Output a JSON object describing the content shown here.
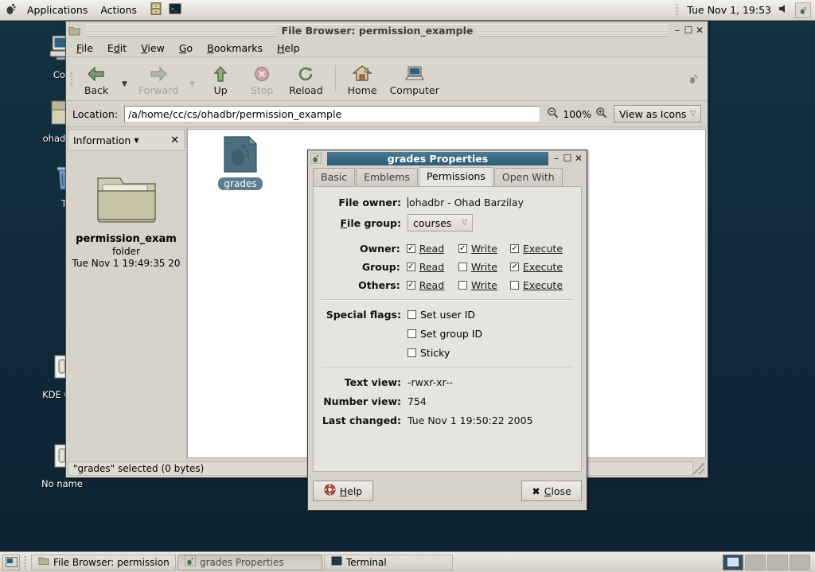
{
  "panel": {
    "menus": [
      "Applications",
      "Actions"
    ],
    "launchers": [
      "file-cabinet-icon",
      "terminal-icon"
    ],
    "clock": "Tue Nov  1, 19:53",
    "tray": [
      "volume-icon",
      "gnome-foot-icon"
    ]
  },
  "desktop": {
    "icons": [
      {
        "name": "Computer",
        "label": "Con",
        "icon": "computer-icon"
      },
      {
        "name": "ohadbr",
        "label": "ohadbr",
        "icon": "home-folder-icon"
      },
      {
        "name": "Trash",
        "label": "Tr",
        "icon": "trash-icon"
      },
      {
        "name": "KDE Connect",
        "label": "KDE Con",
        "icon": "drive-icon"
      },
      {
        "name": "No name",
        "label": "No name",
        "icon": "drive-icon"
      }
    ]
  },
  "file_browser": {
    "title": "File Browser: permission_example",
    "window_buttons": [
      "minimize",
      "maximize",
      "close"
    ],
    "menu": [
      "File",
      "Edit",
      "View",
      "Go",
      "Bookmarks",
      "Help"
    ],
    "toolbar": [
      {
        "label": "Back",
        "icon": "back-arrow-icon",
        "disabled": false,
        "has_menu": true
      },
      {
        "label": "Forward",
        "icon": "forward-arrow-icon",
        "disabled": true,
        "has_menu": true
      },
      {
        "label": "Up",
        "icon": "up-arrow-icon",
        "disabled": false,
        "has_menu": false
      },
      {
        "label": "Stop",
        "icon": "stop-icon",
        "disabled": true,
        "has_menu": false
      },
      {
        "label": "Reload",
        "icon": "reload-icon",
        "disabled": false,
        "has_menu": false
      },
      {
        "label": "Home",
        "icon": "home-icon",
        "disabled": false,
        "has_menu": false
      },
      {
        "label": "Computer",
        "icon": "computer-icon",
        "disabled": false,
        "has_menu": false
      }
    ],
    "location": {
      "label": "Location:",
      "value": "/a/home/cc/cs/ohadbr/permission_example",
      "placeholder": "Location"
    },
    "zoom": {
      "value": "100%",
      "out_icon": "zoom-out-icon",
      "in_icon": "zoom-in-icon"
    },
    "view_selector": "View as Icons",
    "sidepane": {
      "header": "Information",
      "close": "✕",
      "item_name": "permission_exam",
      "item_type": "folder",
      "item_date": "Tue Nov  1 19:49:35 20"
    },
    "files": [
      {
        "name": "grades",
        "icon": "gnome-document-icon",
        "selected": true
      }
    ],
    "status": "\"grades\" selected (0 bytes)"
  },
  "properties_dialog": {
    "title": "grades Properties",
    "tabs": [
      {
        "label": "Basic",
        "active": false
      },
      {
        "label": "Emblems",
        "active": false
      },
      {
        "label": "Permissions",
        "active": true
      },
      {
        "label": "Open With",
        "active": false
      }
    ],
    "file_owner": {
      "label": "File owner:",
      "value": "ohadbr - Ohad Barzilay"
    },
    "file_group": {
      "label": "File group:",
      "value": "courses"
    },
    "permissions": [
      {
        "label": "Owner:",
        "read": true,
        "write": true,
        "execute": true
      },
      {
        "label": "Group:",
        "read": true,
        "write": false,
        "execute": true
      },
      {
        "label": "Others:",
        "read": true,
        "write": false,
        "execute": false
      }
    ],
    "permission_columns": [
      "Read",
      "Write",
      "Execute"
    ],
    "special_flags": {
      "label": "Special flags:",
      "items": [
        {
          "label": "Set user ID",
          "checked": false
        },
        {
          "label": "Set group ID",
          "checked": false
        },
        {
          "label": "Sticky",
          "checked": false
        }
      ]
    },
    "summary": [
      {
        "label": "Text view:",
        "value": "-rwxr-xr--"
      },
      {
        "label": "Number view:",
        "value": "754"
      },
      {
        "label": "Last changed:",
        "value": "Tue Nov  1 19:50:22 2005"
      }
    ],
    "buttons": [
      {
        "label": "Help",
        "icon": "help-icon"
      },
      {
        "label": "Close",
        "icon": "close-x-icon"
      }
    ]
  },
  "taskbar": {
    "show_desktop": "show-desktop-icon",
    "tasks": [
      {
        "label": "File Browser: permission",
        "icon": "folder-icon",
        "active": false
      },
      {
        "label": "grades Properties",
        "icon": "gnome-foot-icon",
        "active": true
      },
      {
        "label": "Terminal",
        "icon": "terminal-icon",
        "active": false
      }
    ],
    "workspaces": 4,
    "active_workspace": 1
  },
  "colors": {
    "desktop_bg": "#13313f",
    "panel_bg": "#e4e2dc",
    "titlebar_active": "#3a6a85",
    "selection": "#5b7d8f",
    "face": "#d6d3cb"
  }
}
